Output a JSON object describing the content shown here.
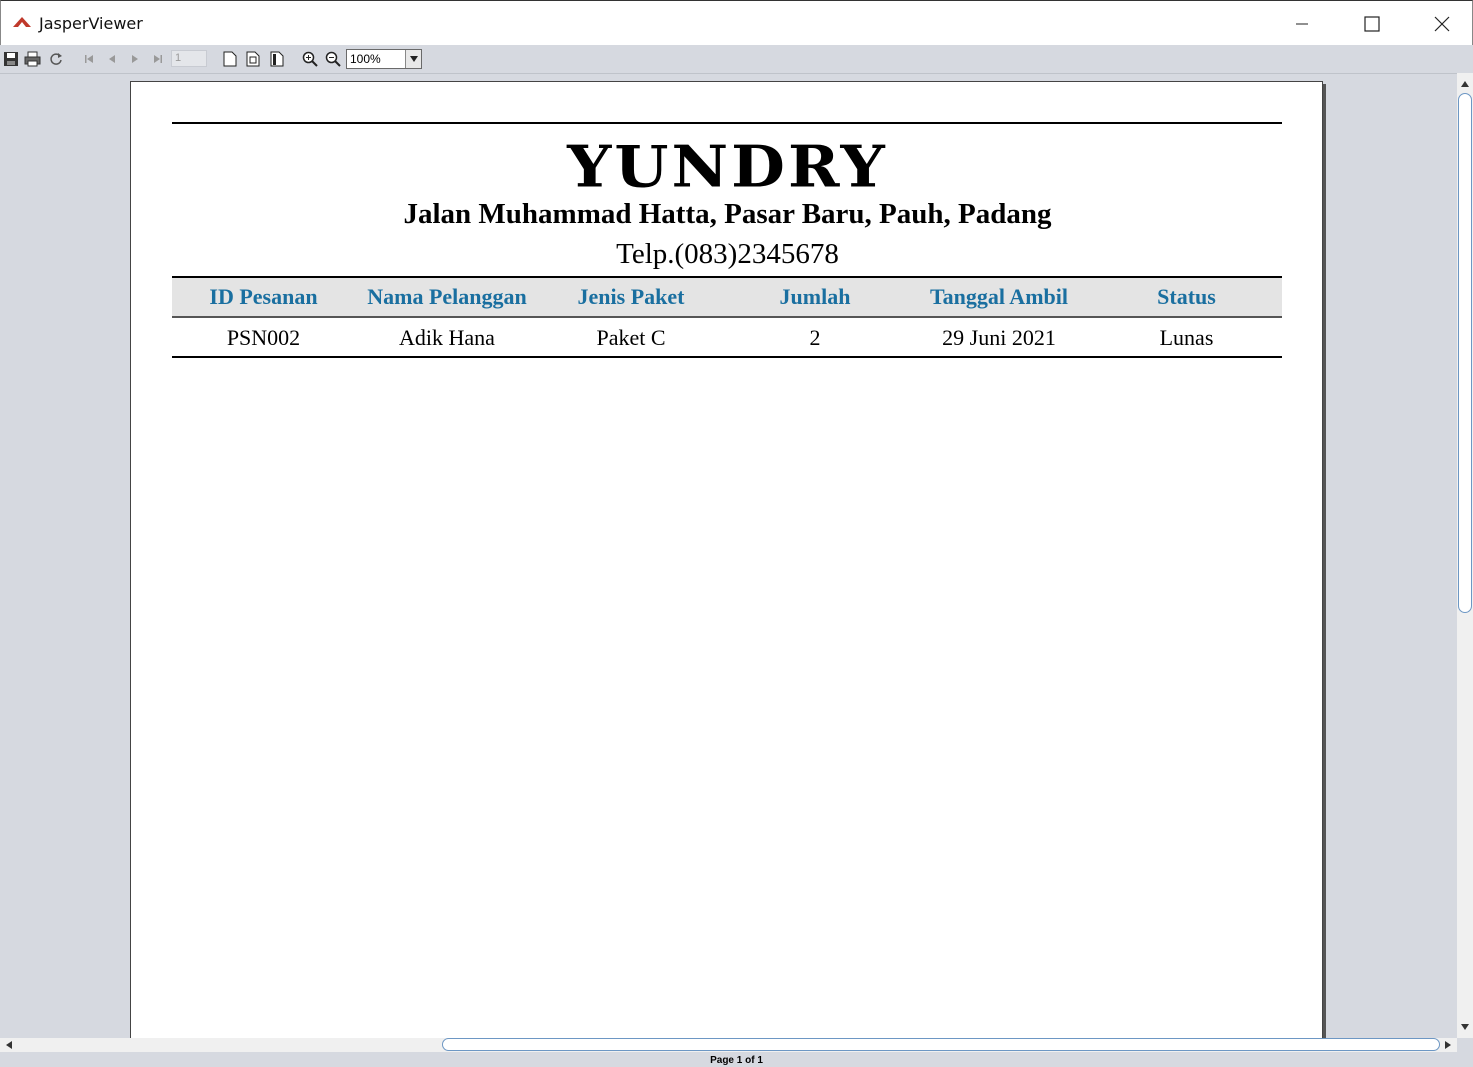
{
  "window": {
    "title": "JasperViewer",
    "controls": {
      "minimize": "minimize",
      "maximize": "maximize",
      "close": "close"
    }
  },
  "toolbar": {
    "buttons": [
      "save-icon",
      "print-icon",
      "reload-icon",
      "first-page-icon",
      "previous-page-icon",
      "next-page-icon",
      "last-page-icon",
      "actual-size-icon",
      "fit-page-icon",
      "fit-width-icon",
      "zoom-in-icon",
      "zoom-out-icon"
    ],
    "page_number": "1",
    "zoom": "100%"
  },
  "report": {
    "company": "YUNDRY",
    "address": "Jalan Muhammad Hatta, Pasar Baru, Pauh, Padang",
    "phone": "Telp.(083)2345678",
    "header_color": "#1a6fa0",
    "columns": [
      "ID Pesanan",
      "Nama Pelanggan",
      "Jenis Paket",
      "Jumlah",
      "Tanggal Ambil",
      "Status"
    ],
    "rows": [
      [
        "PSN002",
        "Adik Hana",
        "Paket C",
        "2",
        "29 Juni 2021",
        "Lunas"
      ]
    ]
  },
  "status": {
    "page_info": "Page 1 of 1"
  }
}
